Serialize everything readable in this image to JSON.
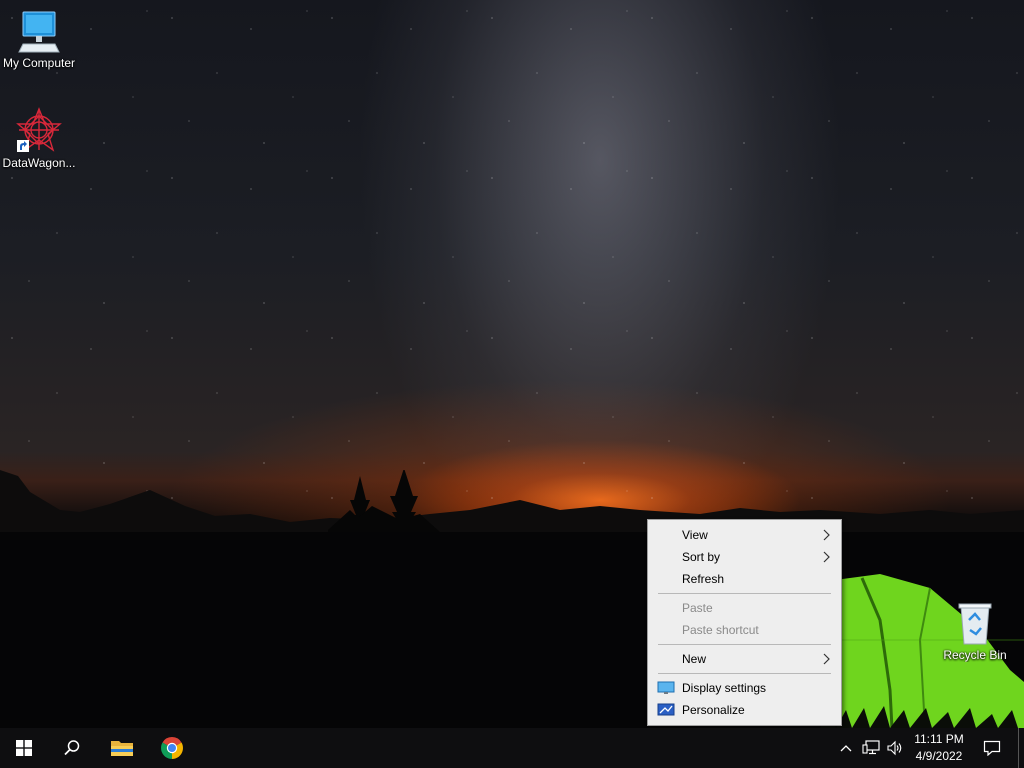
{
  "desktop": {
    "icons": [
      {
        "label": "My Computer",
        "icon": "computer-icon"
      },
      {
        "label": "DataWagon...",
        "icon": "datawagon-shortcut-icon"
      },
      {
        "label": "Recycle Bin",
        "icon": "recycle-bin-icon"
      }
    ]
  },
  "context_menu": {
    "items": [
      {
        "label": "View",
        "submenu": true,
        "enabled": true
      },
      {
        "label": "Sort by",
        "submenu": true,
        "enabled": true
      },
      {
        "label": "Refresh",
        "submenu": false,
        "enabled": true
      },
      {
        "label": "Paste",
        "submenu": false,
        "enabled": false
      },
      {
        "label": "Paste shortcut",
        "submenu": false,
        "enabled": false
      },
      {
        "label": "New",
        "submenu": true,
        "enabled": true
      },
      {
        "label": "Display settings",
        "submenu": false,
        "enabled": true,
        "icon": "display-icon"
      },
      {
        "label": "Personalize",
        "submenu": false,
        "enabled": true,
        "icon": "personalize-icon"
      }
    ]
  },
  "taskbar": {
    "buttons": [
      {
        "name": "start",
        "icon": "windows-logo-icon"
      },
      {
        "name": "search",
        "icon": "search-icon"
      },
      {
        "name": "file-explorer",
        "icon": "folder-icon"
      },
      {
        "name": "chrome",
        "icon": "chrome-icon"
      }
    ],
    "tray": {
      "icons": [
        "chevron-up-icon",
        "network-icon",
        "volume-icon",
        "notifications-icon"
      ],
      "time": "11:11 PM",
      "date": "4/9/2022"
    }
  },
  "colors": {
    "taskbar_bg": "#0e0e10",
    "menu_bg": "#eeeeee",
    "menu_disabled_text": "#8a8a8a",
    "sky_glow": "#ff6e14",
    "tent_green": "#6fd51e"
  }
}
